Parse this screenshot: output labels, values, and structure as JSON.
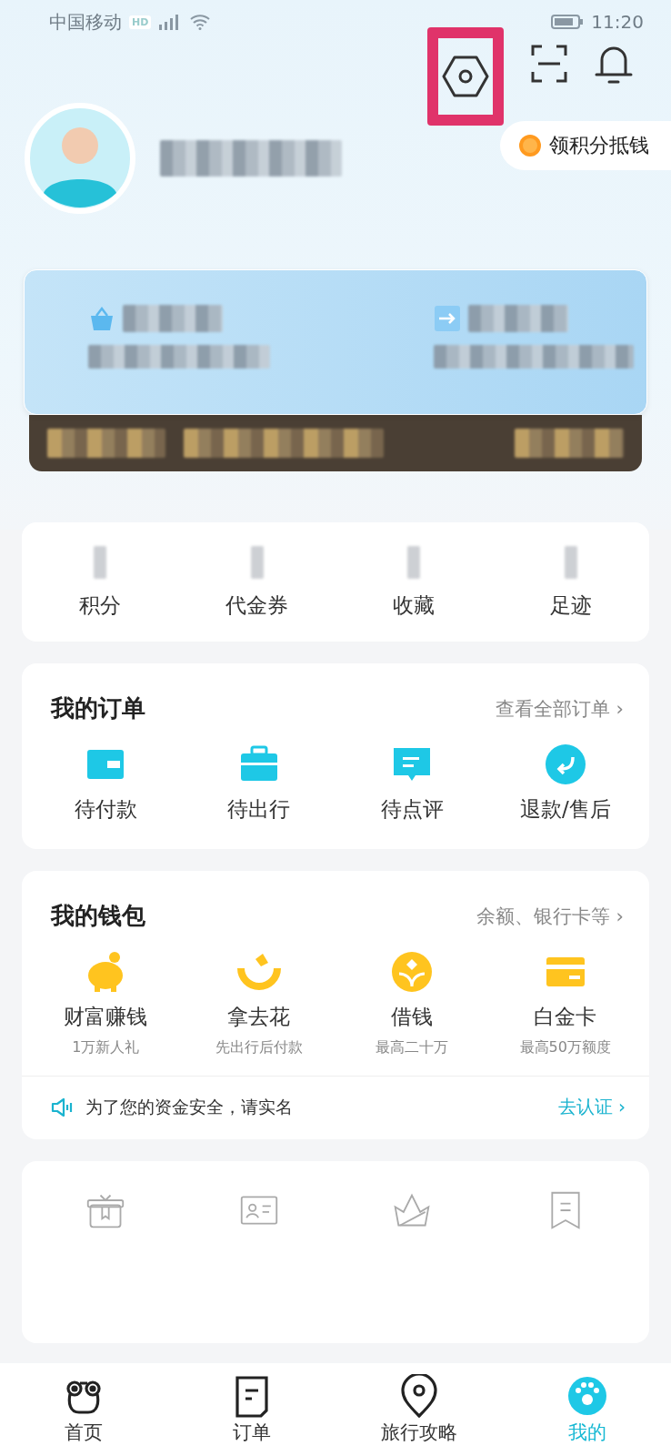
{
  "status_bar": {
    "carrier": "中国移动",
    "network_badge": "HD",
    "time": "11:20"
  },
  "profile": {
    "reward_button": "领积分抵钱"
  },
  "stats": [
    {
      "label": "积分"
    },
    {
      "label": "代金券"
    },
    {
      "label": "收藏"
    },
    {
      "label": "足迹"
    }
  ],
  "orders": {
    "title": "我的订单",
    "link": "查看全部订单 ›",
    "items": [
      {
        "label": "待付款"
      },
      {
        "label": "待出行"
      },
      {
        "label": "待点评"
      },
      {
        "label": "退款/售后"
      }
    ]
  },
  "wallet": {
    "title": "我的钱包",
    "link": "余额、银行卡等 ›",
    "items": [
      {
        "label": "财富赚钱",
        "sub": "1万新人礼"
      },
      {
        "label": "拿去花",
        "sub": "先出行后付款"
      },
      {
        "label": "借钱",
        "sub": "最高二十万"
      },
      {
        "label": "白金卡",
        "sub": "最高50万额度"
      }
    ],
    "notice": {
      "text": "为了您的资金安全，请实名",
      "action": "去认证 ›"
    }
  },
  "tab_bar": [
    {
      "label": "首页",
      "selected": false
    },
    {
      "label": "订单",
      "selected": false
    },
    {
      "label": "旅行攻略",
      "selected": false
    },
    {
      "label": "我的",
      "selected": true
    }
  ]
}
